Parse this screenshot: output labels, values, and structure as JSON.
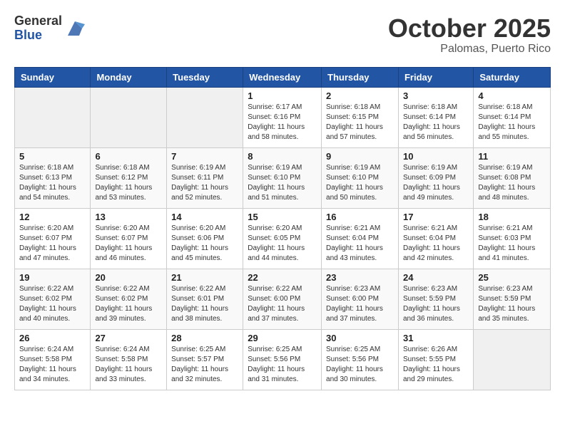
{
  "header": {
    "logo_general": "General",
    "logo_blue": "Blue",
    "month_title": "October 2025",
    "subtitle": "Palomas, Puerto Rico"
  },
  "weekdays": [
    "Sunday",
    "Monday",
    "Tuesday",
    "Wednesday",
    "Thursday",
    "Friday",
    "Saturday"
  ],
  "weeks": [
    [
      {
        "day": "",
        "info": ""
      },
      {
        "day": "",
        "info": ""
      },
      {
        "day": "",
        "info": ""
      },
      {
        "day": "1",
        "info": "Sunrise: 6:17 AM\nSunset: 6:16 PM\nDaylight: 11 hours\nand 58 minutes."
      },
      {
        "day": "2",
        "info": "Sunrise: 6:18 AM\nSunset: 6:15 PM\nDaylight: 11 hours\nand 57 minutes."
      },
      {
        "day": "3",
        "info": "Sunrise: 6:18 AM\nSunset: 6:14 PM\nDaylight: 11 hours\nand 56 minutes."
      },
      {
        "day": "4",
        "info": "Sunrise: 6:18 AM\nSunset: 6:14 PM\nDaylight: 11 hours\nand 55 minutes."
      }
    ],
    [
      {
        "day": "5",
        "info": "Sunrise: 6:18 AM\nSunset: 6:13 PM\nDaylight: 11 hours\nand 54 minutes."
      },
      {
        "day": "6",
        "info": "Sunrise: 6:18 AM\nSunset: 6:12 PM\nDaylight: 11 hours\nand 53 minutes."
      },
      {
        "day": "7",
        "info": "Sunrise: 6:19 AM\nSunset: 6:11 PM\nDaylight: 11 hours\nand 52 minutes."
      },
      {
        "day": "8",
        "info": "Sunrise: 6:19 AM\nSunset: 6:10 PM\nDaylight: 11 hours\nand 51 minutes."
      },
      {
        "day": "9",
        "info": "Sunrise: 6:19 AM\nSunset: 6:10 PM\nDaylight: 11 hours\nand 50 minutes."
      },
      {
        "day": "10",
        "info": "Sunrise: 6:19 AM\nSunset: 6:09 PM\nDaylight: 11 hours\nand 49 minutes."
      },
      {
        "day": "11",
        "info": "Sunrise: 6:19 AM\nSunset: 6:08 PM\nDaylight: 11 hours\nand 48 minutes."
      }
    ],
    [
      {
        "day": "12",
        "info": "Sunrise: 6:20 AM\nSunset: 6:07 PM\nDaylight: 11 hours\nand 47 minutes."
      },
      {
        "day": "13",
        "info": "Sunrise: 6:20 AM\nSunset: 6:07 PM\nDaylight: 11 hours\nand 46 minutes."
      },
      {
        "day": "14",
        "info": "Sunrise: 6:20 AM\nSunset: 6:06 PM\nDaylight: 11 hours\nand 45 minutes."
      },
      {
        "day": "15",
        "info": "Sunrise: 6:20 AM\nSunset: 6:05 PM\nDaylight: 11 hours\nand 44 minutes."
      },
      {
        "day": "16",
        "info": "Sunrise: 6:21 AM\nSunset: 6:04 PM\nDaylight: 11 hours\nand 43 minutes."
      },
      {
        "day": "17",
        "info": "Sunrise: 6:21 AM\nSunset: 6:04 PM\nDaylight: 11 hours\nand 42 minutes."
      },
      {
        "day": "18",
        "info": "Sunrise: 6:21 AM\nSunset: 6:03 PM\nDaylight: 11 hours\nand 41 minutes."
      }
    ],
    [
      {
        "day": "19",
        "info": "Sunrise: 6:22 AM\nSunset: 6:02 PM\nDaylight: 11 hours\nand 40 minutes."
      },
      {
        "day": "20",
        "info": "Sunrise: 6:22 AM\nSunset: 6:02 PM\nDaylight: 11 hours\nand 39 minutes."
      },
      {
        "day": "21",
        "info": "Sunrise: 6:22 AM\nSunset: 6:01 PM\nDaylight: 11 hours\nand 38 minutes."
      },
      {
        "day": "22",
        "info": "Sunrise: 6:22 AM\nSunset: 6:00 PM\nDaylight: 11 hours\nand 37 minutes."
      },
      {
        "day": "23",
        "info": "Sunrise: 6:23 AM\nSunset: 6:00 PM\nDaylight: 11 hours\nand 37 minutes."
      },
      {
        "day": "24",
        "info": "Sunrise: 6:23 AM\nSunset: 5:59 PM\nDaylight: 11 hours\nand 36 minutes."
      },
      {
        "day": "25",
        "info": "Sunrise: 6:23 AM\nSunset: 5:59 PM\nDaylight: 11 hours\nand 35 minutes."
      }
    ],
    [
      {
        "day": "26",
        "info": "Sunrise: 6:24 AM\nSunset: 5:58 PM\nDaylight: 11 hours\nand 34 minutes."
      },
      {
        "day": "27",
        "info": "Sunrise: 6:24 AM\nSunset: 5:58 PM\nDaylight: 11 hours\nand 33 minutes."
      },
      {
        "day": "28",
        "info": "Sunrise: 6:25 AM\nSunset: 5:57 PM\nDaylight: 11 hours\nand 32 minutes."
      },
      {
        "day": "29",
        "info": "Sunrise: 6:25 AM\nSunset: 5:56 PM\nDaylight: 11 hours\nand 31 minutes."
      },
      {
        "day": "30",
        "info": "Sunrise: 6:25 AM\nSunset: 5:56 PM\nDaylight: 11 hours\nand 30 minutes."
      },
      {
        "day": "31",
        "info": "Sunrise: 6:26 AM\nSunset: 5:55 PM\nDaylight: 11 hours\nand 29 minutes."
      },
      {
        "day": "",
        "info": ""
      }
    ]
  ]
}
